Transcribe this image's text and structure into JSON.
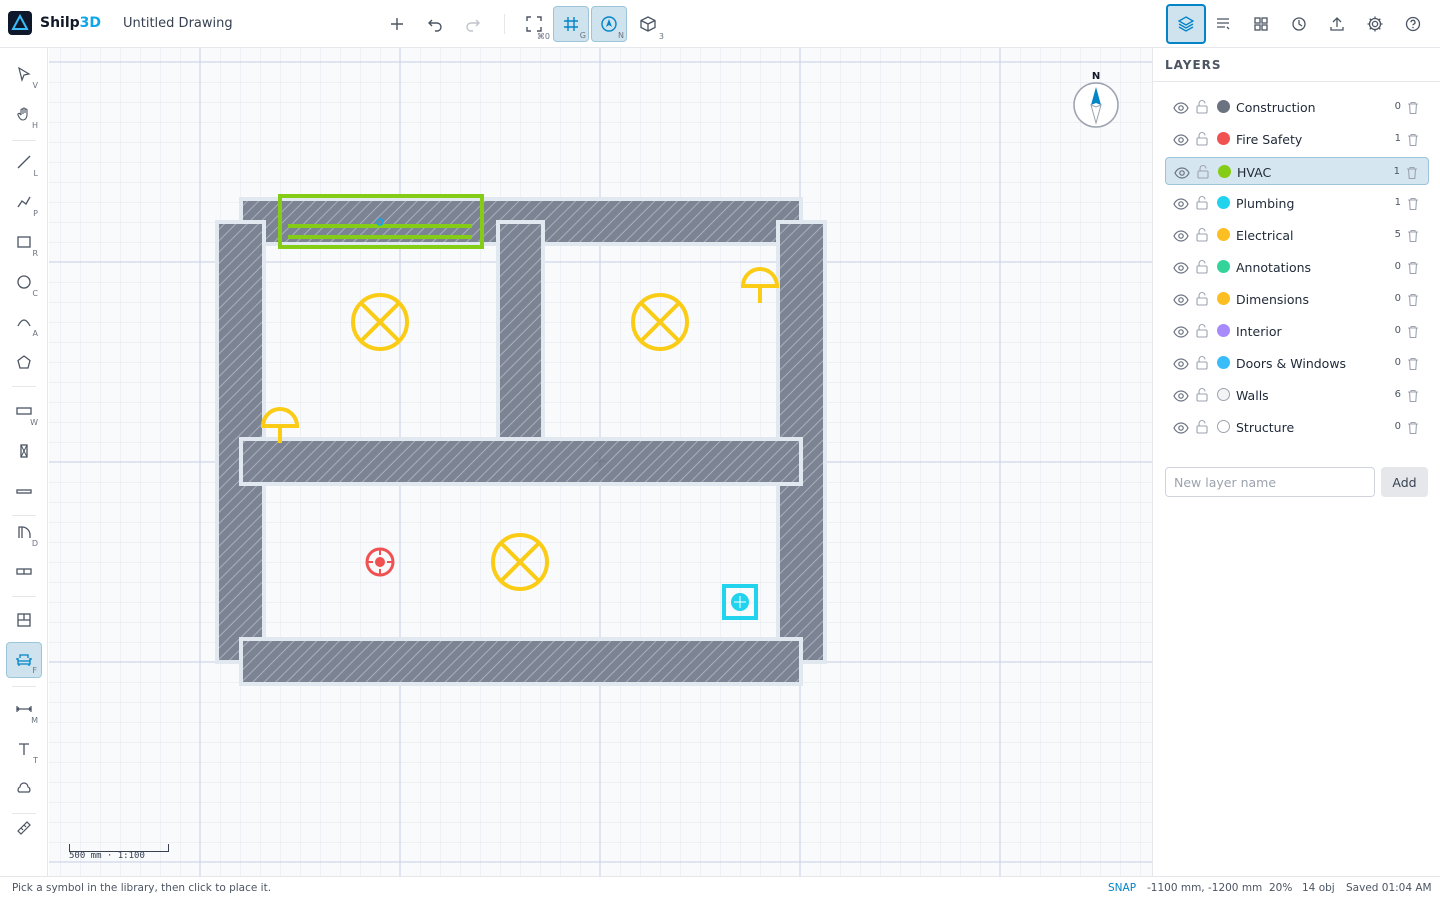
{
  "app": {
    "name_main": "Shilp",
    "name_accent": "3D",
    "doc_title": "Untitled Drawing"
  },
  "toolbar": {
    "new": {
      "icon": "plus-icon"
    },
    "undo": {
      "icon": "undo-icon"
    },
    "redo": {
      "icon": "redo-icon"
    },
    "zoom_fit": {
      "icon": "zoom-fit-icon",
      "key": "⌘0"
    },
    "grid": {
      "icon": "grid-icon",
      "key": "G"
    },
    "snap": {
      "icon": "snap-icon",
      "key": "N"
    },
    "view3d": {
      "icon": "cube-icon",
      "key": "3"
    },
    "right": [
      "layers-icon",
      "properties-icon",
      "library-icon",
      "history-icon",
      "export-icon",
      "settings-icon",
      "help-icon"
    ]
  },
  "tools": [
    {
      "name": "select",
      "key": "V"
    },
    {
      "name": "pan",
      "key": "H"
    },
    {
      "name": "line",
      "key": "L"
    },
    {
      "name": "polyline",
      "key": "P"
    },
    {
      "name": "rectangle",
      "key": "R"
    },
    {
      "name": "circle",
      "key": "C"
    },
    {
      "name": "arc",
      "key": "A"
    },
    {
      "name": "polygon",
      "key": ""
    },
    {
      "name": "wall",
      "key": "W"
    },
    {
      "name": "column",
      "key": ""
    },
    {
      "name": "beam",
      "key": ""
    },
    {
      "name": "door",
      "key": "D"
    },
    {
      "name": "window",
      "key": ""
    },
    {
      "name": "room",
      "key": ""
    },
    {
      "name": "furniture",
      "key": "F"
    },
    {
      "name": "measure",
      "key": "M"
    },
    {
      "name": "text",
      "key": "T"
    },
    {
      "name": "cloud",
      "key": ""
    },
    {
      "name": "ruler",
      "key": ""
    }
  ],
  "compass": {
    "label": "N"
  },
  "scale": {
    "label": "500 mm  ·  1:100"
  },
  "layers_panel": {
    "title": "LAYERS",
    "layers": [
      {
        "name": "Construction",
        "count": "0",
        "color": "#6b7280"
      },
      {
        "name": "Fire Safety",
        "count": "1",
        "color": "#f05252"
      },
      {
        "name": "HVAC",
        "count": "1",
        "color": "#84cc16"
      },
      {
        "name": "Plumbing",
        "count": "1",
        "color": "#22d3ee"
      },
      {
        "name": "Electrical",
        "count": "5",
        "color": "#fbbf24"
      },
      {
        "name": "Annotations",
        "count": "0",
        "color": "#34d399"
      },
      {
        "name": "Dimensions",
        "count": "0",
        "color": "#fbbf24"
      },
      {
        "name": "Interior",
        "count": "0",
        "color": "#a78bfa"
      },
      {
        "name": "Doors & Windows",
        "count": "0",
        "color": "#38bdf8"
      },
      {
        "name": "Walls",
        "count": "6",
        "color": "#f3f4f6"
      },
      {
        "name": "Structure",
        "count": "0",
        "color": "#ffffff"
      }
    ],
    "selected_layer": "HVAC",
    "new_layer_placeholder": "New layer name",
    "add_label": "Add"
  },
  "status": {
    "hint": "Pick a symbol in the library, then click to place it.",
    "snap": "SNAP",
    "coords": "-1100 mm, -1200 mm",
    "zoom": "20%",
    "objects": "14 obj",
    "saved": "Saved 01:04 AM"
  },
  "colors": {
    "accent": "#0284c7",
    "wall": "#6b7280",
    "hvac": "#84cc16",
    "electrical": "#facc15",
    "fire": "#f05252",
    "plumbing": "#22d3ee"
  }
}
